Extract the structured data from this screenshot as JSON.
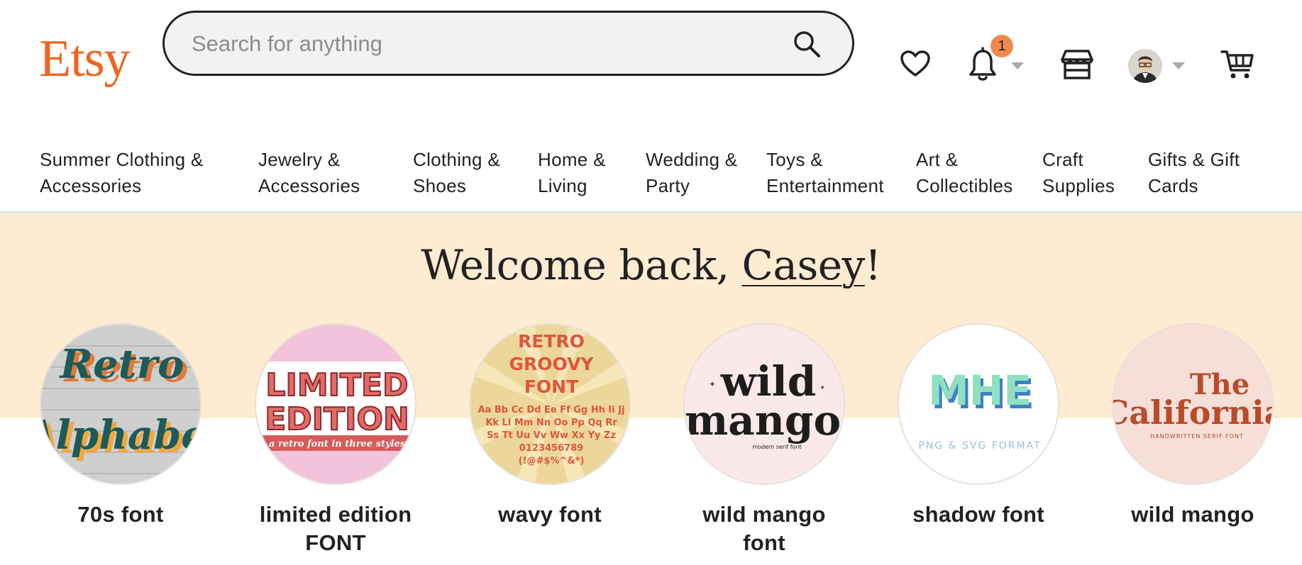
{
  "header": {
    "logo": "Etsy",
    "search_placeholder": "Search for anything",
    "notification_count": "1",
    "brand_color": "#F1641E",
    "icons": [
      "heart-icon",
      "bell-icon",
      "shop-icon",
      "avatar",
      "cart-icon"
    ]
  },
  "nav": {
    "categories": [
      {
        "line1": "Summer Clothing &",
        "line2": "Accessories"
      },
      {
        "line1": "Jewelry &",
        "line2": "Accessories"
      },
      {
        "line1": "Clothing &",
        "line2": "Shoes"
      },
      {
        "line1": "Home &",
        "line2": "Living"
      },
      {
        "line1": "Wedding &",
        "line2": "Party"
      },
      {
        "line1": "Toys &",
        "line2": "Entertainment"
      },
      {
        "line1": "Art &",
        "line2": "Collectibles"
      },
      {
        "line1": "Craft",
        "line2": "Supplies"
      },
      {
        "line1": "Gifts & Gift",
        "line2": "Cards"
      }
    ]
  },
  "hero": {
    "welcome_prefix": "Welcome back, ",
    "user_name": "Casey",
    "welcome_suffix": "!",
    "background": "#FDEBD2"
  },
  "recent_searches": [
    {
      "label": "70s font",
      "image_text": [
        "Retro",
        "Alphabet"
      ]
    },
    {
      "label": "limited edition FONT",
      "image_text": [
        "LIMITED",
        "EDITION",
        "a retro font in three styles"
      ]
    },
    {
      "label": "wavy font",
      "image_text": [
        "RETRO",
        "GROOVY",
        "FONT",
        "Aa Bb Cc Dd Ee Ff Gg Hh Ii Jj",
        "Kk Ll Mm Nn Oo Pp Qq Rr",
        "Ss Tt Uu Vv Ww Xx Yy Zz",
        "0123456789",
        "(!@#$%^&*)"
      ]
    },
    {
      "label": "wild mango font",
      "image_text": [
        "wild",
        "mango",
        "modern serif font"
      ]
    },
    {
      "label": "shadow font",
      "image_text": [
        "MHE",
        "PNG & SVG FORMAT"
      ]
    },
    {
      "label": "wild mango",
      "image_text": [
        "The",
        "California",
        "HANDWRITTEN SERIF FONT"
      ]
    }
  ]
}
